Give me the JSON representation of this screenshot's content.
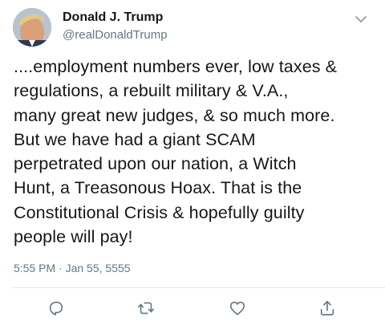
{
  "author": {
    "display_name": "Donald J. Trump",
    "handle": "@realDonaldTrump"
  },
  "tweet": {
    "text": "....employment numbers ever, low taxes &\nregulations, a rebuilt military & V.A.,\nmany great new judges, & so much more.\nBut we have had a giant SCAM\nperpetrated upon our nation, a Witch\nHunt, a Treasonous Hoax. That is the\nConstitutional Crisis & hopefully guilty\npeople will pay!",
    "time": "5:55 PM",
    "separator": " · ",
    "date": "Jan 55, 5555"
  },
  "icons": {
    "caret": "chevron-down-icon",
    "reply": "reply-icon",
    "retweet": "retweet-icon",
    "like": "heart-icon",
    "share": "share-icon"
  },
  "colors": {
    "text": "#14171a",
    "secondary": "#657786",
    "divider": "#e1e8ed"
  }
}
